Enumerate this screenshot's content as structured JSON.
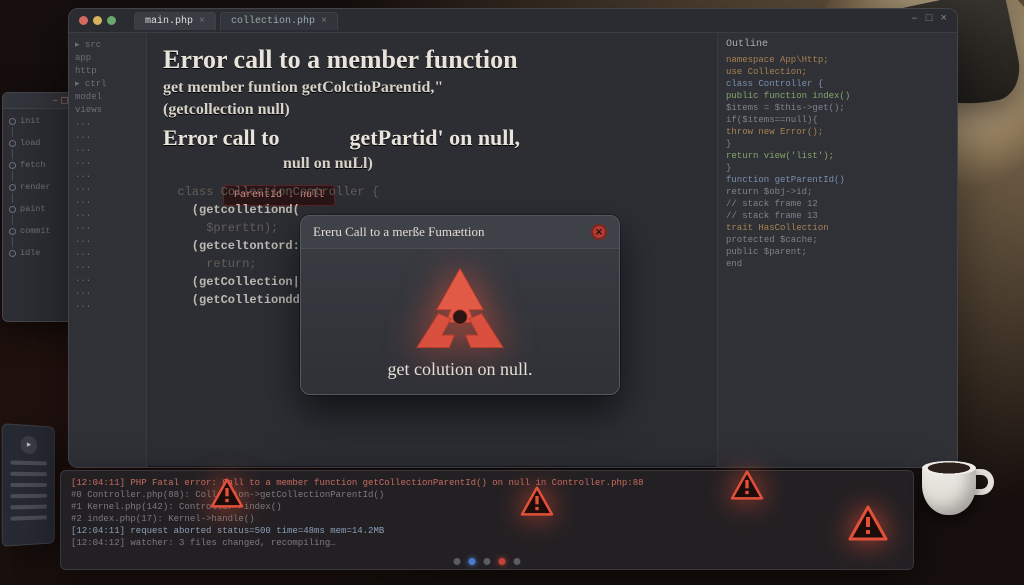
{
  "titlebar": {
    "tabs": [
      {
        "label": "main.php",
        "active": true
      },
      {
        "label": "collection.php",
        "active": false
      }
    ]
  },
  "toolbar": {
    "min": "–",
    "max": "□",
    "close": "×"
  },
  "hero": {
    "line1": "Error call to a member function",
    "line2a": "get member funtion getColctioParentid,\"",
    "line2b": "(getcollection null)",
    "line3_left": "Error call to",
    "line3_right": "getPartid' on null,",
    "line4": "null on nuLl)",
    "redchip": "ParentId : null"
  },
  "bgcode": [
    "  class CollectionController {",
    "    (getcolletiond(",
    "      $prerttn);",
    "    (getceltontord:",
    "      return;",
    "    (getCollection|gottsrantd\"",
    "    (getColletionddon .:murilL)"
  ],
  "dialog": {
    "title": "Ereru Call to a merße Fumættion",
    "footer": "get colution on null."
  },
  "rightpane": {
    "header": "Outline",
    "lines": [
      "namespace App\\Http;",
      "use Collection;",
      "class Controller {",
      "  public function index()",
      "  $items = $this->get();",
      "  if($items==null){",
      "    throw new Error();",
      "  }",
      "  return view('list');",
      "}",
      "function getParentId()",
      "  return $obj->id;",
      "// stack frame 12",
      "// stack frame 13",
      "trait HasCollection",
      "  protected $cache;",
      "  public $parent;",
      "end"
    ]
  },
  "gutter": [
    "▸ src",
    "  app",
    "  http",
    "▸ ctrl",
    "  model",
    "  views",
    "  ...",
    "  ...",
    "  ...",
    "  ...",
    "  ...",
    "  ...",
    "  ...",
    "  ...",
    "  ...",
    "  ...",
    "  ...",
    "  ...",
    "  ...",
    "  ...",
    "  ..."
  ],
  "sidewin": {
    "close": "–◻✕",
    "nodes": [
      "init",
      "load",
      "fetch",
      "render",
      "paint",
      "commit",
      "idle"
    ]
  },
  "console": {
    "rows": [
      "[12:04:11] PHP Fatal error:  Call to a member function getCollectionParentId() on null in Controller.php:88",
      "#0 Controller.php(88): Collection->getCollectionParentId()",
      "#1 Kernel.php(142): Controller->index()",
      "#2 index.php(17): Kernel->handle()",
      "[12:04:11] request aborted  status=500  time=48ms  mem=14.2MB",
      "[12:04:12] watcher: 3 files changed, recompiling…"
    ]
  },
  "icons": {
    "warning": "warning-triangle-icon",
    "stop": "stop-icon",
    "logo": "error-logo-icon"
  }
}
